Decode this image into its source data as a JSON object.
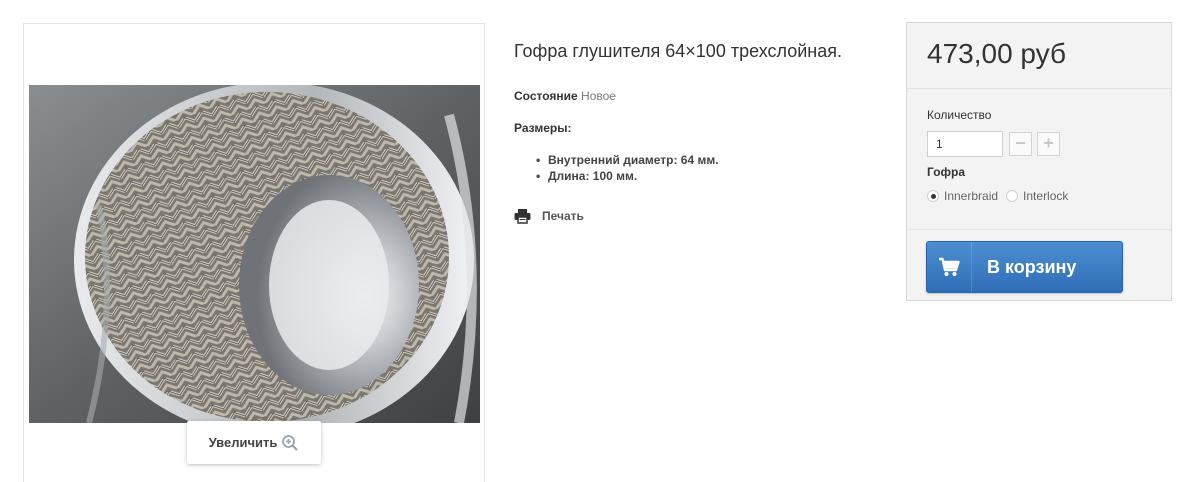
{
  "product": {
    "title": "Гофра глушителя 64×100 трехслойная.",
    "condition_label": "Состояние",
    "condition_value": "Новое",
    "sizes_heading": "Размеры:",
    "sizes": [
      "Внутренний диаметр: 64 мм.",
      "Длина: 100 мм."
    ],
    "print_label": "Печать",
    "zoom_label": "Увеличить"
  },
  "buy": {
    "price": "473,00 руб",
    "quantity_label": "Количество",
    "quantity_value": "1",
    "minus": "−",
    "plus": "+",
    "gofra_label": "Гофра",
    "options": [
      {
        "label": "Innerbraid",
        "checked": true
      },
      {
        "label": "Interlock",
        "checked": false
      }
    ],
    "cart_label": "В корзину"
  },
  "colors": {
    "cart_blue": "#3a7bc8",
    "panel_bg": "#f3f3f3"
  },
  "icons": {
    "zoom": "zoom-in-icon",
    "print": "printer-icon",
    "cart": "shopping-cart-icon"
  }
}
